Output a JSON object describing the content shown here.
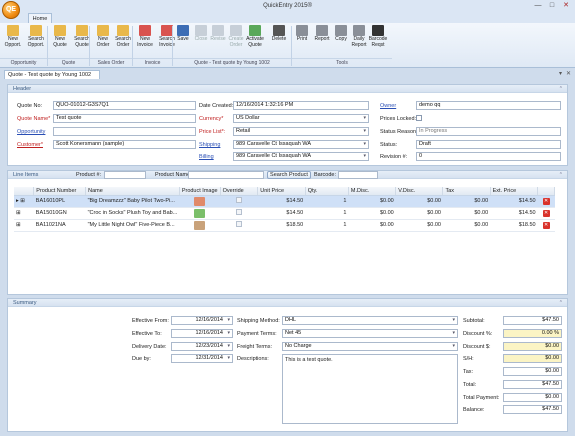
{
  "window": {
    "title": "QuickEntry 2015®",
    "app_logo": "QE",
    "minimize": "—",
    "maximize": "□",
    "close": "✕"
  },
  "ribbon": {
    "tab": "Home",
    "buttons": [
      {
        "label": "New Opport.",
        "icon": "folder-new-icon",
        "color": "#e9b84a",
        "disabled": false
      },
      {
        "label": "Search Opport.",
        "icon": "folder-search-icon",
        "color": "#e9b84a",
        "disabled": false
      },
      {
        "label": "New Quote",
        "icon": "folder-new-icon",
        "color": "#e9b84a",
        "disabled": false
      },
      {
        "label": "Search Quote",
        "icon": "folder-search-icon",
        "color": "#e9b84a",
        "disabled": false
      },
      {
        "label": "New Order",
        "icon": "order-new-icon",
        "color": "#e9b84a",
        "disabled": false
      },
      {
        "label": "Search Order",
        "icon": "order-search-icon",
        "color": "#e9b84a",
        "disabled": false
      },
      {
        "label": "New Invoice",
        "icon": "invoice-new-icon",
        "color": "#d9534f",
        "disabled": false
      },
      {
        "label": "Search Invoice",
        "icon": "invoice-search-icon",
        "color": "#d9534f",
        "disabled": false
      },
      {
        "label": "Save",
        "icon": "save-icon",
        "color": "#3d6db5",
        "disabled": false
      },
      {
        "label": "Close",
        "icon": "close-doc-icon",
        "color": "#c7cfd8",
        "disabled": true
      },
      {
        "label": "Revise",
        "icon": "revise-icon",
        "color": "#c7cfd8",
        "disabled": true
      },
      {
        "label": "Create Order",
        "icon": "create-order-icon",
        "color": "#c7cfd8",
        "disabled": true
      },
      {
        "label": "Activate Quote",
        "icon": "activate-icon",
        "color": "#5aa85a",
        "disabled": false
      },
      {
        "label": "Delete",
        "icon": "delete-icon",
        "color": "#555555",
        "disabled": false
      },
      {
        "label": "Print",
        "icon": "print-icon",
        "color": "#8a8f98",
        "disabled": false
      },
      {
        "label": "Report",
        "icon": "report-icon",
        "color": "#8a8f98",
        "disabled": false
      },
      {
        "label": "Copy",
        "icon": "copy-icon",
        "color": "#8a8f98",
        "disabled": false
      },
      {
        "label": "Daily Report",
        "icon": "daily-report-icon",
        "color": "#8a8f98",
        "disabled": false
      },
      {
        "label": "Barcode Reqst",
        "icon": "barcode-icon",
        "color": "#333333",
        "disabled": false
      }
    ],
    "groups": [
      {
        "label": "Opportunity"
      },
      {
        "label": "Quote"
      },
      {
        "label": "Sales Order"
      },
      {
        "label": "Invoice"
      },
      {
        "label": "Quote - Test quote by Young 1002"
      },
      {
        "label": "Tools"
      }
    ]
  },
  "doc_tab": {
    "label": "Quote - Test quote by Young 1002",
    "close": "✕",
    "pin": "▾"
  },
  "header": {
    "title": "Header",
    "collapse": "⌃",
    "quote_no_label": "Quote No:",
    "quote_no": "QUO-01012-G3S7Q1",
    "quote_name_label": "Quote Name*",
    "quote_name": "Test quote",
    "opportunity_label": "Opportunity",
    "opportunity": "",
    "customer_label": "Customer*",
    "customer": "Scott Konersmann (sample)",
    "date_created_label": "Date Created:",
    "date_created": "12/16/2014 1:32:16 PM",
    "currency_label": "Currency*",
    "currency": "US Dollar",
    "price_list_label": "Price List*:",
    "price_list": "Retail",
    "shipping_label": "Shipping",
    "shipping": "989 Caravelle Ct Issaquah WA",
    "billing_label": "Billing",
    "billing": "989 Caravelle Ct Issaquah WA",
    "owner_label": "Owner",
    "owner": "demo qq",
    "prices_locked_label": "Prices Locked:",
    "status_reason_label": "Status Reason:",
    "status_reason": "In Progress",
    "status_label": "Status:",
    "status": "Draft",
    "revision_label": "Revision #:",
    "revision": "0"
  },
  "line_items": {
    "title": "Line Items",
    "collapse": "⌃",
    "product_no_label": "Product #:",
    "product_name_label": "Product Name:",
    "search_button": "Search Product",
    "barcode_label": "Barcode:",
    "columns": [
      "Product Number",
      "Name",
      "Product Image",
      "Override",
      "Unit Price",
      "Qty.",
      "M.Disc.",
      "V.Disc.",
      "Tax",
      "Ext. Price"
    ],
    "rows": [
      {
        "number": "BA16010PL",
        "name": "\"Big Dreamzzz\" Baby Pilot Two-Pi...",
        "image_color": "#e08a6a",
        "unit": "$14.50",
        "qty": "1",
        "mdisc": "$0.00",
        "vdisc": "$0.00",
        "tax": "$0.00",
        "ext": "$14.50"
      },
      {
        "number": "BA15010GN",
        "name": "\"Croc in Socks\" Plush Toy and Bab...",
        "image_color": "#7bbf6a",
        "unit": "$14.50",
        "qty": "1",
        "mdisc": "$0.00",
        "vdisc": "$0.00",
        "tax": "$0.00",
        "ext": "$14.50"
      },
      {
        "number": "BA11021NA",
        "name": "\"My Little Night Owl\" Five-Piece B...",
        "image_color": "#c9a27a",
        "unit": "$18.50",
        "qty": "1",
        "mdisc": "$0.00",
        "vdisc": "$0.00",
        "tax": "$0.00",
        "ext": "$18.50"
      }
    ]
  },
  "summary": {
    "title": "Summary",
    "collapse": "⌃",
    "effective_from_label": "Effective From:",
    "effective_from": "12/16/2014",
    "effective_to_label": "Effective To:",
    "effective_to": "12/16/2014",
    "delivery_date_label": "Delivery Date:",
    "delivery_date": "12/23/2014",
    "due_by_label": "Due by:",
    "due_by": "12/31/2014",
    "shipping_method_label": "Shipping Method:",
    "shipping_method": "DHL",
    "payment_terms_label": "Payment Terms:",
    "payment_terms": "Net 45",
    "freight_terms_label": "Freight Terms:",
    "freight_terms": "No Charge",
    "descriptions_label": "Descriptions:",
    "description": "This is a test quote.",
    "subtotal_label": "Subtotal:",
    "subtotal": "$47.50",
    "discount_pct_label": "Discount %:",
    "discount_pct": "0.00 %",
    "discount_amt_label": "Discount $:",
    "discount_amt": "$0.00",
    "sh_label": "S/H:",
    "sh": "$0.00",
    "tax_label": "Tax:",
    "tax": "$0.00",
    "total_label": "Total:",
    "total": "$47.50",
    "total_payment_label": "Total Payment:",
    "total_payment": "$0.00",
    "balance_label": "Balance:",
    "balance": "$47.50"
  }
}
